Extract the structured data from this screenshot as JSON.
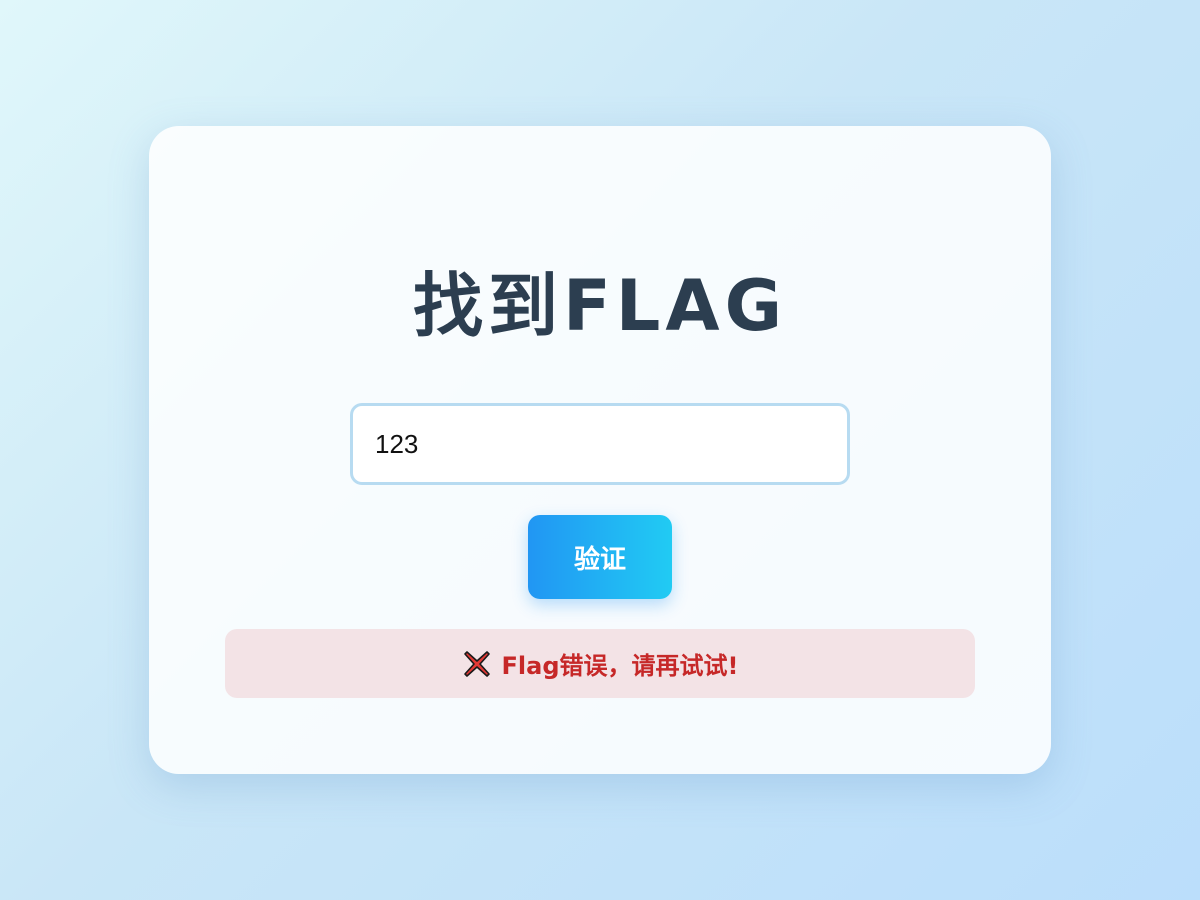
{
  "page": {
    "title": "找到FLAG"
  },
  "form": {
    "flag_input_value": "123",
    "verify_button_label": "验证"
  },
  "message": {
    "icon": "cross-mark-icon",
    "text": "Flag错误，请再试试!",
    "color": "#c62828",
    "background": "#f3e3e6"
  },
  "colors": {
    "title": "#2c3e50",
    "button_start": "#2196f3",
    "button_end": "#21cbf3",
    "input_border": "#b7dbf1"
  }
}
